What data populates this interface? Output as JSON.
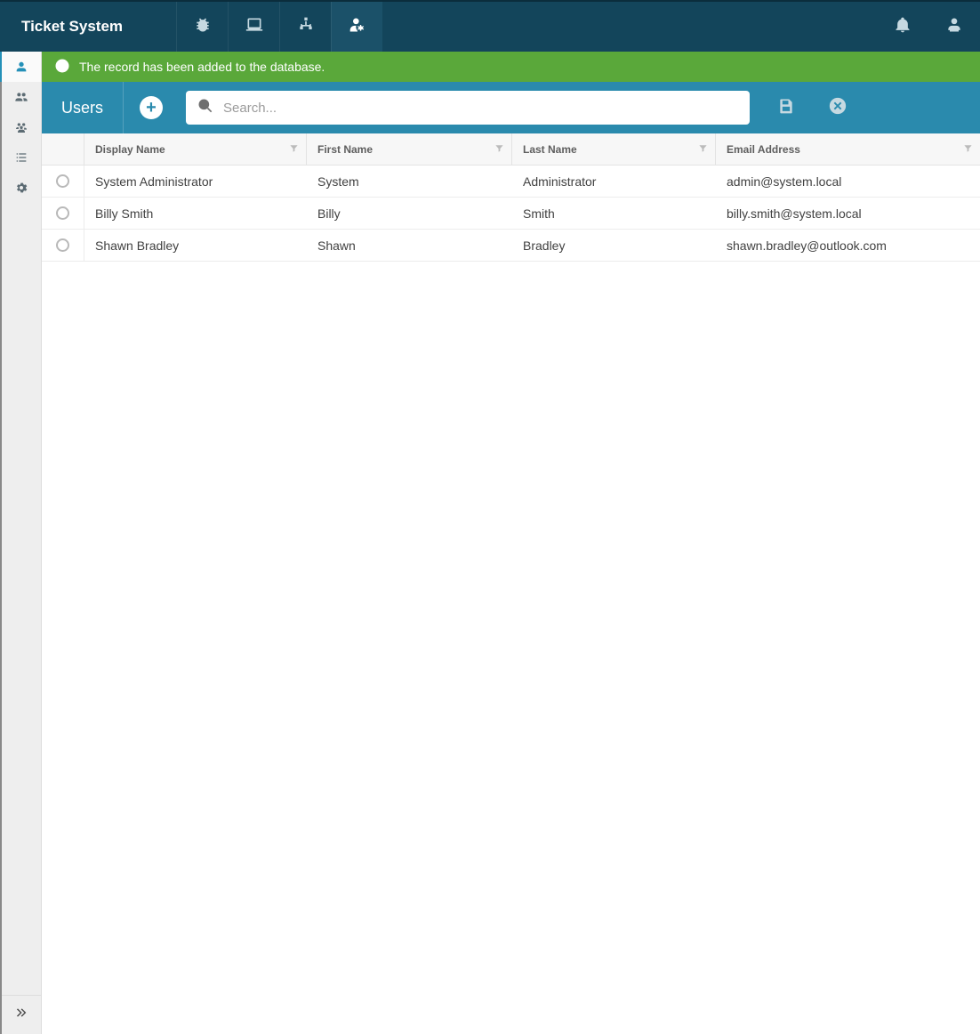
{
  "app_title": "Ticket System",
  "notice": {
    "message": "The record has been added to the database."
  },
  "page": {
    "title": "Users",
    "search_placeholder": "Search..."
  },
  "columns": {
    "display_name": "Display Name",
    "first_name": "First Name",
    "last_name": "Last Name",
    "email": "Email Address"
  },
  "rows": [
    {
      "display_name": "System Administrator",
      "first_name": "System",
      "last_name": "Administrator",
      "email": "admin@system.local"
    },
    {
      "display_name": "Billy Smith",
      "first_name": "Billy",
      "last_name": "Smith",
      "email": "billy.smith@system.local"
    },
    {
      "display_name": "Shawn Bradley",
      "first_name": "Shawn",
      "last_name": "Bradley",
      "email": "shawn.bradley@outlook.com"
    }
  ]
}
